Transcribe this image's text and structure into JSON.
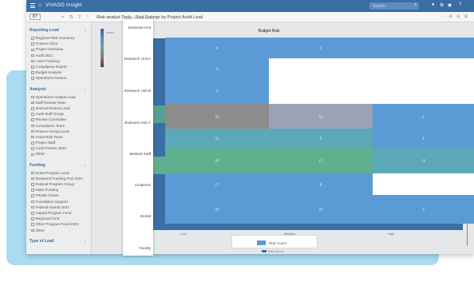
{
  "window": {
    "title": "VIVADO Insight",
    "search_placeholder": "Search",
    "icons": [
      "menu-icon",
      "home-icon",
      "search-icon",
      "user-icon",
      "settings-icon",
      "bell-icon",
      "help-icon"
    ]
  },
  "toolbar": {
    "back_label": "BT",
    "breadcrumb": "Risk analyst Tools - Risk Ratings by Project Audit Lead",
    "right_icons": "⋯ ⊞ ⊟ ⊠"
  },
  "sidebar": {
    "sections": [
      {
        "title": "Reporting Lead",
        "items": [
          "Regional Risk Summary",
          "Finance 2022",
          "Project Overview",
          "Audit 2021",
          "Asset Tracking",
          "Compliance Report",
          "Budget Analysis",
          "Operations Review"
        ]
      },
      {
        "title": "Analysts",
        "items": [
          "Operations Analyst Lead",
          "Staff Review Team",
          "Internal Review Lead",
          "Audit Staff Group",
          "Review Committee",
          "Compliance Team",
          "Finance Group Lead",
          "Asset Risk Team",
          "Project Staff",
          "Audit Review 2022",
          "Other"
        ]
      },
      {
        "title": "Funding",
        "items": [
          "Grant Program Lead",
          "Research Funding Pool 2021",
          "Federal Program Group",
          "State Funding",
          "Private Grants",
          "Foundation Support",
          "Federal Grants 2022",
          "Capital Program Fund",
          "Regional Fund",
          "Other Program Fund 2023",
          "Other"
        ]
      },
      {
        "title": "Type of Lead",
        "items": []
      }
    ]
  },
  "background_chart": {
    "legend_label": "Level",
    "axis_ticks": [
      "Low",
      "Medium",
      "High"
    ],
    "legend_item": "Risk Score"
  },
  "categories_panel": {
    "labels": [
      "Business Unit",
      "Research Unit A",
      "Research Unit B",
      "Business Unit C",
      "Medical Staff",
      "Academic",
      "Dental",
      "Faculty"
    ]
  },
  "chart_data": {
    "type": "heatmap",
    "title": "Budget Risk",
    "rows": [
      "Business Unit",
      "Research Unit A",
      "Research Unit B",
      "Business Unit C",
      "Medical Staff",
      "Academic",
      "Dental"
    ],
    "columns": [
      "Low",
      "Medium",
      "High"
    ],
    "values": [
      [
        4,
        2,
        null
      ],
      [
        4,
        null,
        null
      ],
      [
        3,
        null,
        null
      ],
      [
        22,
        14,
        2
      ],
      [
        11,
        5,
        1
      ],
      [
        20,
        17,
        13
      ],
      [
        17,
        8,
        null
      ],
      [
        33,
        23,
        3
      ]
    ],
    "cell_colors": [
      [
        "#5b9bd5",
        "#5b9bd5",
        "#5b9bd5"
      ],
      [
        "#5b9bd5",
        "#ffffff",
        "#ffffff"
      ],
      [
        "#5b9bd5",
        "#ffffff",
        "#ffffff"
      ],
      [
        "#8c8c8c",
        "#9aa3b5",
        "#5b9bd5"
      ],
      [
        "#5aa8b8",
        "#5aa8b8",
        "#5b9bd5"
      ],
      [
        "#5fb08e",
        "#5fb08e",
        "#5aa8b8"
      ],
      [
        "#5b9bd5",
        "#5b9bd5",
        "#ffffff"
      ],
      [
        "#5b9bd5",
        "#5b9bd5",
        "#5b9bd5"
      ]
    ],
    "legend": [
      "Risk Count"
    ],
    "colors": {
      "primary": "#5b9bd5",
      "grey": "#8c8c8c",
      "teal": "#5aa8b8",
      "green": "#5fb08e"
    }
  }
}
